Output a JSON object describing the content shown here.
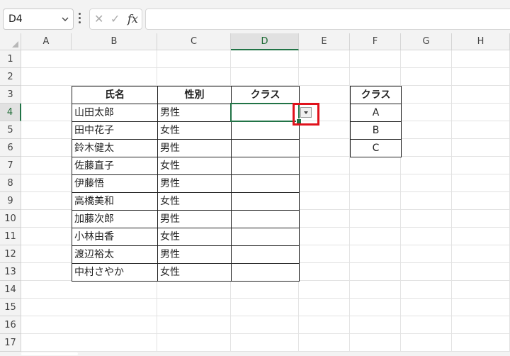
{
  "formula_bar": {
    "name_box": "D4",
    "cancel_symbol": "✕",
    "enter_symbol": "✓",
    "fx_label": "fx",
    "formula": ""
  },
  "columns": [
    "A",
    "B",
    "C",
    "D",
    "E",
    "F",
    "G",
    "H"
  ],
  "selected_column": "D",
  "rows": [
    "1",
    "2",
    "3",
    "4",
    "5",
    "6",
    "7",
    "8",
    "9",
    "10",
    "11",
    "12",
    "13",
    "14",
    "15",
    "16",
    "17"
  ],
  "selected_row": "4",
  "main_table": {
    "headers": [
      "氏名",
      "性別",
      "クラス"
    ],
    "rows": [
      [
        "山田太郎",
        "男性",
        ""
      ],
      [
        "田中花子",
        "女性",
        ""
      ],
      [
        "鈴木健太",
        "男性",
        ""
      ],
      [
        "佐藤直子",
        "女性",
        ""
      ],
      [
        "伊藤悟",
        "男性",
        ""
      ],
      [
        "高橋美和",
        "女性",
        ""
      ],
      [
        "加藤次郎",
        "男性",
        ""
      ],
      [
        "小林由香",
        "女性",
        ""
      ],
      [
        "渡辺裕太",
        "男性",
        ""
      ],
      [
        "中村さやか",
        "女性",
        ""
      ]
    ]
  },
  "class_table": {
    "header": "クラス",
    "items": [
      "A",
      "B",
      "C"
    ]
  },
  "colors": {
    "selection_green": "#217346",
    "highlight_red": "#e0121c"
  },
  "icons": {
    "namebox_dropdown": "chevron-down-icon",
    "list_dropdown": "dropdown-arrow-icon"
  }
}
